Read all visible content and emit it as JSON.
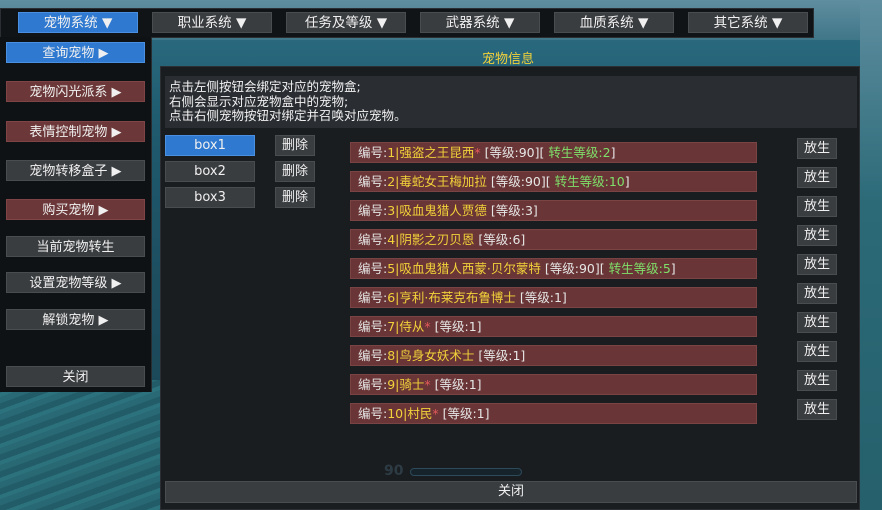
{
  "top_menu": [
    {
      "label": "宠物系统 ▼",
      "active": true
    },
    {
      "label": "职业系统 ▼"
    },
    {
      "label": "任务及等级 ▼"
    },
    {
      "label": "武器系统 ▼"
    },
    {
      "label": "血质系统 ▼"
    },
    {
      "label": "其它系统 ▼"
    }
  ],
  "left_menu": [
    {
      "label": "查询宠物  ▶"
    },
    {
      "label": "宠物闪光派系  ▶"
    },
    {
      "label": "表情控制宠物  ▶"
    },
    {
      "label": "宠物转移盒子  ▶"
    },
    {
      "label": "购买宠物  ▶"
    },
    {
      "label": "当前宠物转生"
    },
    {
      "label": "设置宠物等级  ▶"
    },
    {
      "label": "解锁宠物  ▶"
    },
    {
      "label": "关闭"
    }
  ],
  "panel": {
    "title": "宠物信息",
    "info_lines": [
      "点击左侧按钮会绑定对应的宠物盒;",
      "右侧会显示对应宠物盒中的宠物;",
      "点击右侧宠物按钮对绑定并召唤对应宠物。"
    ],
    "boxes": [
      "box1",
      "box2",
      "box3"
    ],
    "delete_label": "删除",
    "release_label": "放生",
    "close_label": "关闭",
    "deco_number": "90"
  },
  "pets": [
    {
      "id_label": "编号:",
      "num": "1|",
      "name": "强盗之王昆西",
      "star": "*",
      "level": " [等级:",
      "level_val": "90]",
      "rebirth_open": "[",
      "rebirth": "转生等级:2",
      "rebirth_close": "]"
    },
    {
      "id_label": "编号:",
      "num": "2|",
      "name": "毒蛇女王梅加拉",
      "star": "",
      "level": " [等级:",
      "level_val": "90]",
      "rebirth_open": "[",
      "rebirth": "转生等级:10",
      "rebirth_close": "]"
    },
    {
      "id_label": "编号:",
      "num": "3|",
      "name": "吸血鬼猎人贾德",
      "star": "",
      "level": " [等级:",
      "level_val": "3]",
      "rebirth_open": "",
      "rebirth": "",
      "rebirth_close": ""
    },
    {
      "id_label": "编号:",
      "num": "4|",
      "name": "阴影之刃贝恩",
      "star": "",
      "level": " [等级:",
      "level_val": "6]",
      "rebirth_open": "",
      "rebirth": "",
      "rebirth_close": ""
    },
    {
      "id_label": "编号:",
      "num": "5|",
      "name": "吸血鬼猎人西蒙·贝尔蒙特",
      "star": "",
      "level": " [等级:",
      "level_val": "90]",
      "rebirth_open": "[",
      "rebirth": "转生等级:5",
      "rebirth_close": "]"
    },
    {
      "id_label": "编号:",
      "num": "6|",
      "name": "亨利·布莱克布鲁博士",
      "star": "",
      "level": " [等级:",
      "level_val": "1]",
      "rebirth_open": "",
      "rebirth": "",
      "rebirth_close": ""
    },
    {
      "id_label": "编号:",
      "num": "7|",
      "name": "侍从",
      "star": "*",
      "level": " [等级:",
      "level_val": "1]",
      "rebirth_open": "",
      "rebirth": "",
      "rebirth_close": ""
    },
    {
      "id_label": "编号:",
      "num": "8|",
      "name": "鸟身女妖术士",
      "star": "",
      "level": " [等级:",
      "level_val": "1]",
      "rebirth_open": "",
      "rebirth": "",
      "rebirth_close": ""
    },
    {
      "id_label": "编号:",
      "num": "9|",
      "name": "骑士",
      "star": "*",
      "level": " [等级:",
      "level_val": "1]",
      "rebirth_open": "",
      "rebirth": "",
      "rebirth_close": ""
    },
    {
      "id_label": "编号:",
      "num": "10|",
      "name": "村民",
      "star": "*",
      "level": " [等级:",
      "level_val": "1]",
      "rebirth_open": "",
      "rebirth": "",
      "rebirth_close": ""
    }
  ]
}
